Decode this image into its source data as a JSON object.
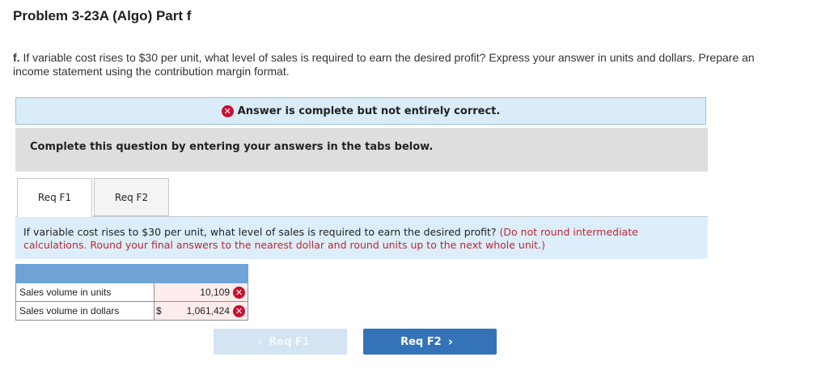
{
  "header": {
    "title": "Problem 3-23A (Algo) Part f"
  },
  "question": {
    "letter": "f.",
    "text": "If variable cost rises to $30 per unit, what level of sales is required to earn the desired profit? Express your answer in units and dollars. Prepare an income statement using the contribution margin format."
  },
  "status": {
    "icon": "x-circle-icon",
    "text": "Answer is complete but not entirely correct."
  },
  "instruction": {
    "text": "Complete this question by entering your answers in the tabs below."
  },
  "tabs": [
    {
      "label": "Req F1",
      "active": true
    },
    {
      "label": "Req F2",
      "active": false
    }
  ],
  "prompt": {
    "text": "If variable cost rises to $30 per unit, what level of sales is required to earn the desired profit?",
    "hint": "(Do not round intermediate calculations. Round your final answers to the nearest dollar and round units up to the next whole unit.)"
  },
  "table": {
    "rows": [
      {
        "label": "Sales volume in units",
        "currency": "",
        "value": "10,109",
        "status": "incorrect"
      },
      {
        "label": "Sales volume in dollars",
        "currency": "$",
        "value": "1,061,424",
        "status": "incorrect"
      }
    ]
  },
  "nav": {
    "prev_label": "Req F1",
    "next_label": "Req F2",
    "prev_chevron": "‹",
    "next_chevron": "›"
  },
  "colors": {
    "header_row": "#6fa3d6",
    "error": "#c8102e",
    "next_button": "#3573b9"
  }
}
